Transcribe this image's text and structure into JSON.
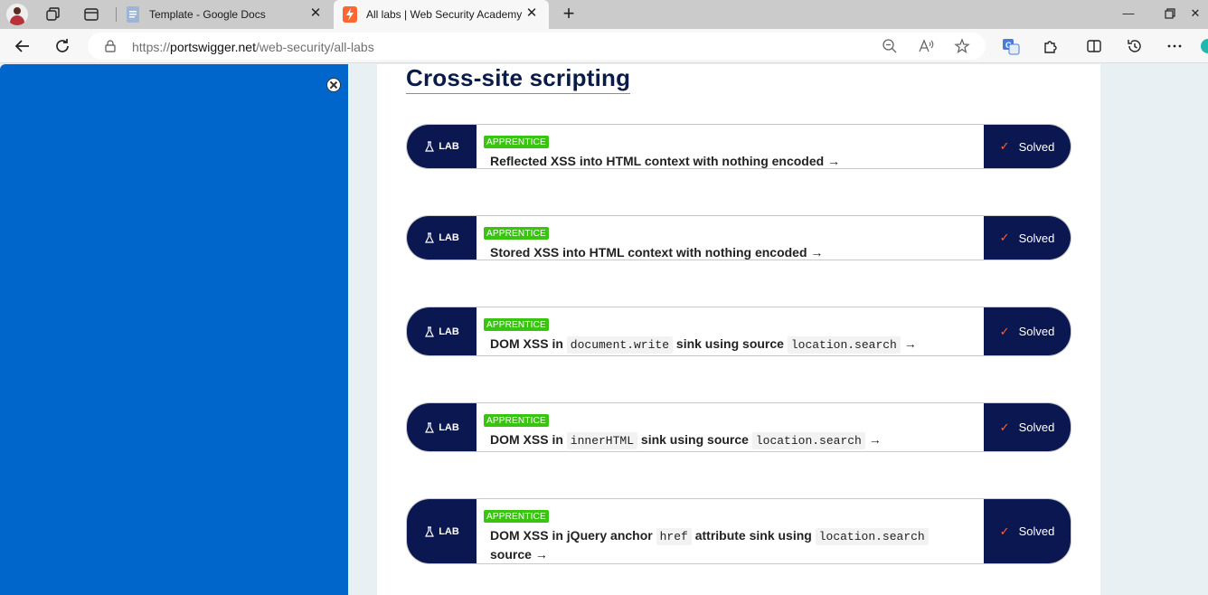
{
  "browser": {
    "tabs": [
      {
        "title": "Template - Google Docs",
        "favicon": "google-docs-icon",
        "active": false
      },
      {
        "title": "All labs | Web Security Academy",
        "favicon": "portswigger-icon",
        "active": true
      }
    ],
    "new_tab_icon": "plus-icon",
    "window_controls": [
      "minimize-icon",
      "restore-icon",
      "close-icon"
    ],
    "address": {
      "scheme": "https://",
      "host": "portswigger.net",
      "path": "/web-security/all-labs"
    }
  },
  "colors": {
    "sidebar_blue": "#0066cc",
    "navy": "#0a1750",
    "apprentice_green": "#38c411",
    "accent_orange": "#ff6633"
  },
  "section": {
    "title": "Cross-site scripting"
  },
  "labs": [
    {
      "badge": "LAB",
      "level": "APPRENTICE",
      "status": "Solved",
      "title_parts": [
        "Reflected XSS into HTML context with nothing encoded",
        "→"
      ]
    },
    {
      "badge": "LAB",
      "level": "APPRENTICE",
      "status": "Solved",
      "title_parts": [
        "Stored XSS into HTML context with nothing encoded",
        "→"
      ]
    },
    {
      "badge": "LAB",
      "level": "APPRENTICE",
      "status": "Solved",
      "title_parts": [
        "DOM XSS in",
        "document.write",
        "sink using source",
        "location.search",
        "→"
      ]
    },
    {
      "badge": "LAB",
      "level": "APPRENTICE",
      "status": "Solved",
      "title_parts": [
        "DOM XSS in",
        "innerHTML",
        "sink using source",
        "location.search",
        "→"
      ]
    },
    {
      "badge": "LAB",
      "level": "APPRENTICE",
      "status": "Solved",
      "title_parts": [
        "DOM XSS in jQuery anchor",
        "href",
        "attribute sink using",
        "location.search",
        "source",
        "→"
      ]
    }
  ]
}
